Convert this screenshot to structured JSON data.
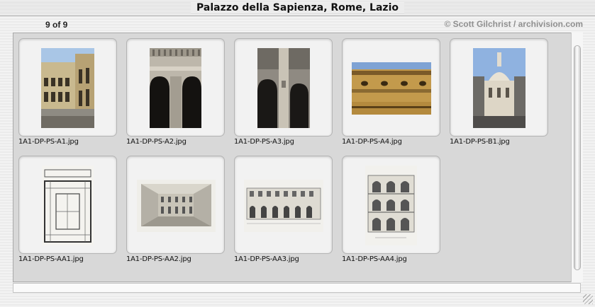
{
  "window": {
    "title": "Palazzo della Sapienza, Rome, Lazio"
  },
  "header": {
    "count_label": "9 of 9",
    "credit": "© Scott Gilchrist / archivision.com"
  },
  "thumbnails": [
    {
      "filename": "1A1-DP-PS-A1.jpg",
      "icon": "photo-icon"
    },
    {
      "filename": "1A1-DP-PS-A2.jpg",
      "icon": "photo-icon"
    },
    {
      "filename": "1A1-DP-PS-A3.jpg",
      "icon": "photo-icon"
    },
    {
      "filename": "1A1-DP-PS-A4.jpg",
      "icon": "photo-icon"
    },
    {
      "filename": "1A1-DP-PS-B1.jpg",
      "icon": "photo-icon"
    },
    {
      "filename": "1A1-DP-PS-AA1.jpg",
      "icon": "drawing-icon"
    },
    {
      "filename": "1A1-DP-PS-AA2.jpg",
      "icon": "drawing-icon"
    },
    {
      "filename": "1A1-DP-PS-AA3.jpg",
      "icon": "drawing-icon"
    },
    {
      "filename": "1A1-DP-PS-AA4.jpg",
      "icon": "drawing-icon"
    }
  ]
}
